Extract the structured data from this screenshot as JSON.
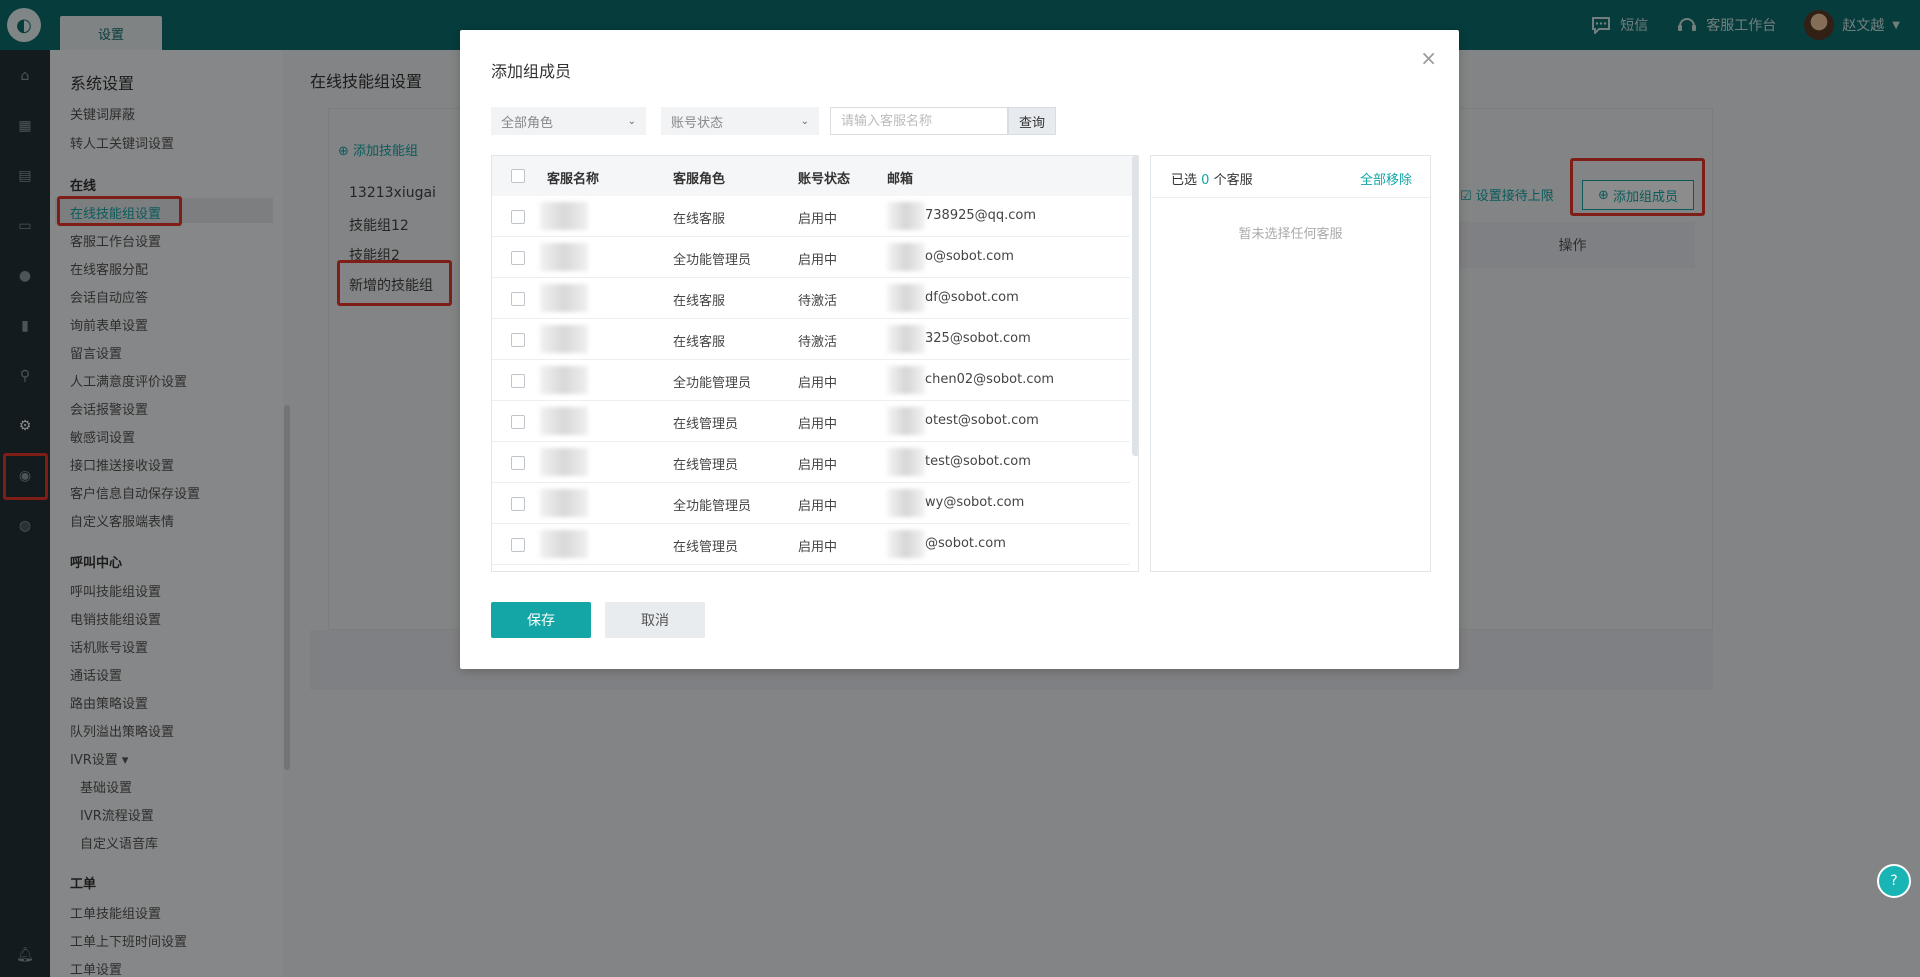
{
  "topbar": {
    "tab": "设置",
    "sms": "短信",
    "workbench": "客服工作台",
    "user": "赵文越"
  },
  "menu": {
    "title": "系统设置",
    "items_top": [
      "关键词屏蔽",
      "转人工关键词设置"
    ],
    "section_online": "在线",
    "online_items": [
      "在线技能组设置",
      "客服工作台设置",
      "在线客服分配",
      "会话自动应答",
      "询前表单设置",
      "留言设置",
      "人工满意度评价设置",
      "会话报警设置",
      "敏感词设置",
      "接口推送接收设置",
      "客户信息自动保存设置",
      "自定义客服端表情"
    ],
    "section_call": "呼叫中心",
    "call_items": [
      "呼叫技能组设置",
      "电销技能组设置",
      "话机账号设置",
      "通话设置",
      "路由策略设置",
      "队列溢出策略设置",
      "IVR设置 ▾"
    ],
    "ivr_sub": [
      "基础设置",
      "IVR流程设置",
      "自定义语音库"
    ],
    "section_ticket": "工单",
    "ticket_items": [
      "工单技能组设置",
      "工单上下班时间设置",
      "工单设置"
    ]
  },
  "content": {
    "title": "在线技能组设置",
    "add_group": "添加技能组",
    "groups": [
      "13213xiugai",
      "技能组12",
      "技能组2",
      "新增的技能组"
    ],
    "set_limit": "设置接待上限",
    "add_member": "添加组成员",
    "op_header": "操作"
  },
  "dialog": {
    "title": "添加组成员",
    "role_filter": "全部角色",
    "status_filter": "账号状态",
    "search_placeholder": "请输入客服名称",
    "query": "查询",
    "columns": [
      "客服名称",
      "客服角色",
      "账号状态",
      "邮箱"
    ],
    "rows": [
      {
        "role": "在线客服",
        "status": "启用中",
        "email": "738925@qq.com"
      },
      {
        "role": "全功能管理员",
        "status": "启用中",
        "email": "o@sobot.com"
      },
      {
        "role": "在线客服",
        "status": "待激活",
        "email": "df@sobot.com"
      },
      {
        "role": "在线客服",
        "status": "待激活",
        "email": "325@sobot.com"
      },
      {
        "role": "全功能管理员",
        "status": "启用中",
        "email": "chen02@sobot.com"
      },
      {
        "role": "在线管理员",
        "status": "启用中",
        "email": "otest@sobot.com"
      },
      {
        "role": "在线管理员",
        "status": "启用中",
        "email": "test@sobot.com"
      },
      {
        "role": "全功能管理员",
        "status": "启用中",
        "email": "wy@sobot.com"
      },
      {
        "role": "在线管理员",
        "status": "启用中",
        "email": "@sobot.com"
      }
    ],
    "selected_prefix": "已选",
    "selected_count": "0",
    "selected_suffix": "个客服",
    "remove_all": "全部移除",
    "empty_text": "暂未选择任何客服",
    "save": "保存",
    "cancel": "取消"
  },
  "help": "?"
}
